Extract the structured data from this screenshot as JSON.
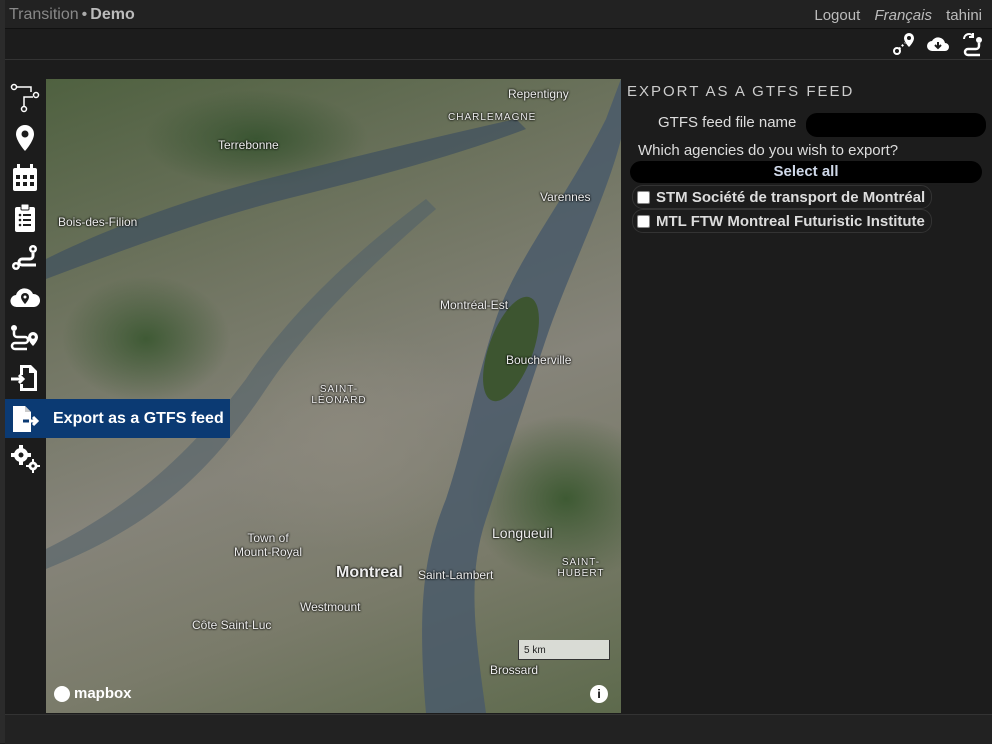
{
  "header": {
    "app_name": "Transition",
    "separator": "•",
    "project_name": "Demo",
    "links": [
      "Logout",
      "Français",
      "tahini"
    ]
  },
  "toolbar": {
    "icons": [
      "route-pin-icon",
      "cloud-download-icon",
      "route-refresh-icon"
    ]
  },
  "sidebar": {
    "items": [
      {
        "icon": "network-graph-icon"
      },
      {
        "icon": "map-pin-icon"
      },
      {
        "icon": "calendar-icon"
      },
      {
        "icon": "clipboard-list-icon"
      },
      {
        "icon": "route-icon"
      },
      {
        "icon": "cloud-map-icon"
      },
      {
        "icon": "route-analysis-icon"
      },
      {
        "icon": "file-import-icon"
      },
      {
        "icon": "file-export-icon"
      },
      {
        "icon": "settings-icon"
      }
    ],
    "active_tooltip": "Export as a GTFS feed",
    "tooltip_color": "#0b3a73"
  },
  "map": {
    "labels": [
      "Repentigny",
      "CHARLEMAGNE",
      "Terrebonne",
      "Varennes",
      "Bois-des-Filion",
      "Montréal-Est",
      "Boucherville",
      "SAINT-LÉONARD",
      "Longueuil",
      "Town of Mount-Royal",
      "Montreal",
      "Saint-Lambert",
      "SAINT-HUBERT",
      "Westmount",
      "Côte Saint-Luc",
      "Brossard"
    ],
    "scale_label": "5 km",
    "attribution": "mapbox",
    "info": "i"
  },
  "panel": {
    "title": "EXPORT AS A GTFS FEED",
    "file_name_label": "GTFS feed file name",
    "file_name_value": "",
    "agencies_question": "Which agencies do you wish to export?",
    "select_all_label": "Select all",
    "agencies": [
      {
        "label": "STM Société de transport de Montréal",
        "checked": false
      },
      {
        "label": "MTL FTW Montreal Futuristic Institute",
        "checked": false
      }
    ]
  }
}
